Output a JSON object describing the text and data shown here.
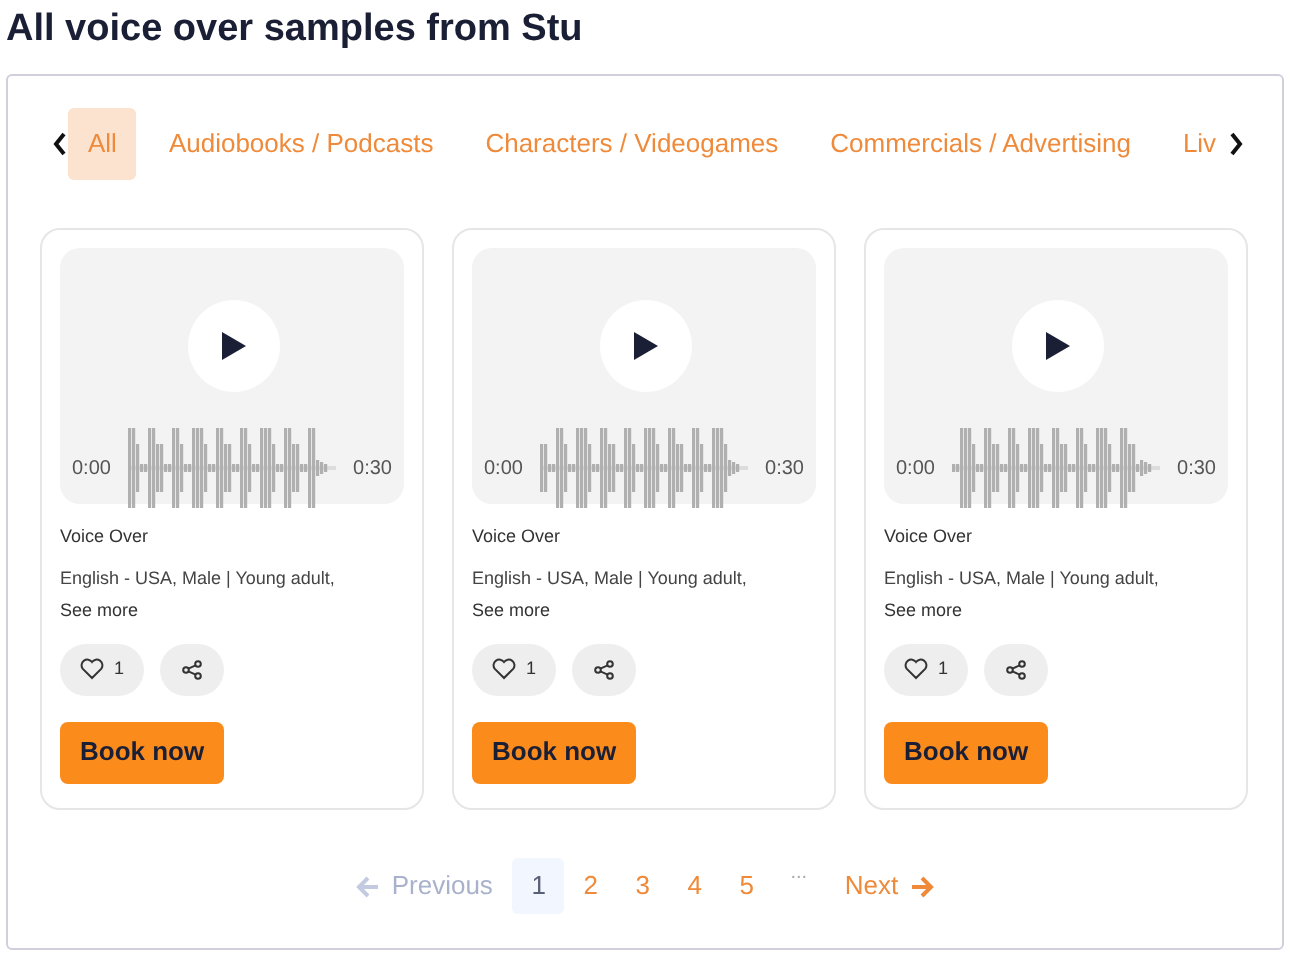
{
  "title": "All voice over samples from Stu",
  "tabs": [
    {
      "label": "All",
      "selected": true
    },
    {
      "label": "Audiobooks / Podcasts",
      "selected": false
    },
    {
      "label": "Characters / Videogames",
      "selected": false
    },
    {
      "label": "Commercials / Advertising",
      "selected": false
    },
    {
      "label": "Liv",
      "selected": false
    }
  ],
  "cards": [
    {
      "start_time": "0:00",
      "end_time": "0:30",
      "category": "Voice Over",
      "details": "English - USA, Male | Young adult,",
      "see_more": "See more",
      "likes": "1",
      "button": "Book now"
    },
    {
      "start_time": "0:00",
      "end_time": "0:30",
      "category": "Voice Over",
      "details": "English - USA, Male | Young adult,",
      "see_more": "See more",
      "likes": "1",
      "button": "Book now"
    },
    {
      "start_time": "0:00",
      "end_time": "0:30",
      "category": "Voice Over",
      "details": "English - USA, Male | Young adult,",
      "see_more": "See more",
      "likes": "1",
      "button": "Book now"
    }
  ],
  "pagination": {
    "previous": {
      "label": "Previous",
      "disabled": true
    },
    "pages": [
      {
        "label": "1",
        "selected": true
      },
      {
        "label": "2",
        "selected": false
      },
      {
        "label": "3",
        "selected": false
      },
      {
        "label": "4",
        "selected": false
      },
      {
        "label": "5",
        "selected": false
      }
    ],
    "ellipsis": "...",
    "next": {
      "label": "Next",
      "disabled": false
    }
  }
}
